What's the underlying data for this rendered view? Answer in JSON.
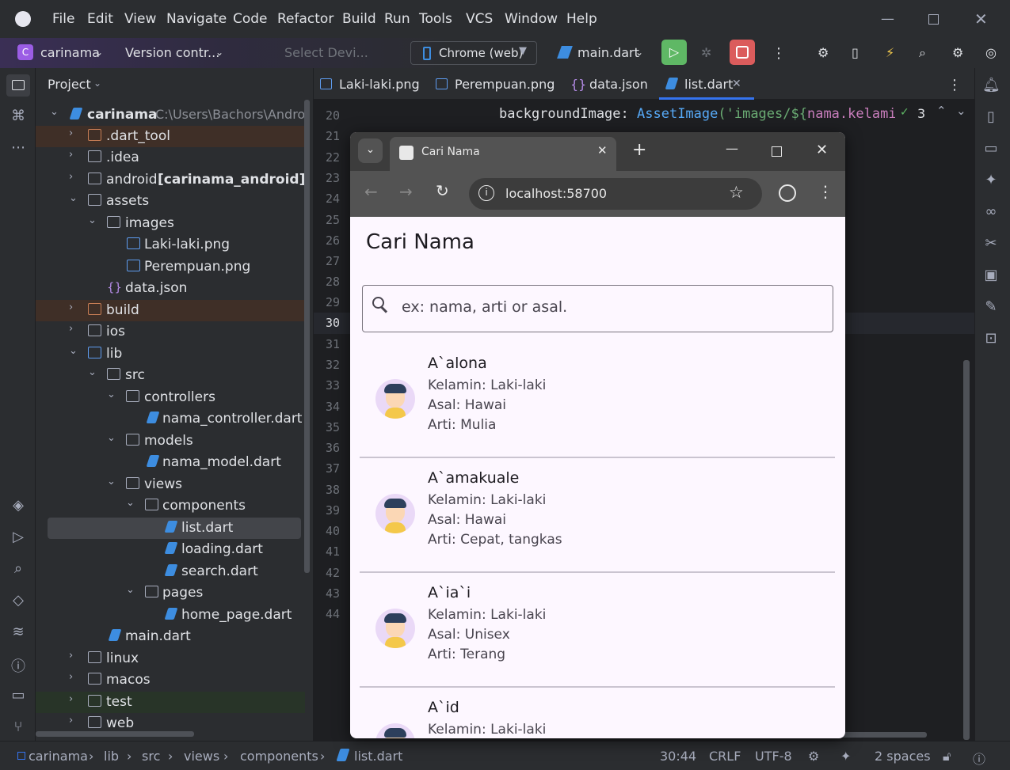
{
  "menu": [
    "File",
    "Edit",
    "View",
    "Navigate",
    "Code",
    "Refactor",
    "Build",
    "Run",
    "Tools",
    "VCS",
    "Window",
    "Help"
  ],
  "toolbar": {
    "project_badge": "C",
    "project": "carinama",
    "vcs": "Version contr...",
    "device_placeholder": "Select Devi...",
    "device": "Chrome (web)",
    "run_config": "main.dart"
  },
  "project_panel": {
    "title": "Project",
    "root_name": "carinama",
    "root_path": "C:\\Users\\Bachors\\Androic",
    "items": [
      {
        "label": ".dart_tool"
      },
      {
        "label": ".idea"
      },
      {
        "label": "android"
      },
      {
        "label": "[carinama_android]"
      },
      {
        "label": "assets"
      },
      {
        "label": "images"
      },
      {
        "label": "Laki-laki.png"
      },
      {
        "label": "Perempuan.png"
      },
      {
        "label": "data.json"
      },
      {
        "label": "build"
      },
      {
        "label": "ios"
      },
      {
        "label": "lib"
      },
      {
        "label": "src"
      },
      {
        "label": "controllers"
      },
      {
        "label": "nama_controller.dart"
      },
      {
        "label": "models"
      },
      {
        "label": "nama_model.dart"
      },
      {
        "label": "views"
      },
      {
        "label": "components"
      },
      {
        "label": "list.dart"
      },
      {
        "label": "loading.dart"
      },
      {
        "label": "search.dart"
      },
      {
        "label": "pages"
      },
      {
        "label": "home_page.dart"
      },
      {
        "label": "main.dart"
      },
      {
        "label": "linux"
      },
      {
        "label": "macos"
      },
      {
        "label": "test"
      },
      {
        "label": "web"
      }
    ]
  },
  "editor": {
    "tabs": [
      "Laki-laki.png",
      "Perempuan.png",
      "data.json",
      "list.dart"
    ],
    "code_line_20": {
      "key": "backgroundImage:",
      "cls": "AssetImage",
      "str": "('images/${",
      "var": "nama.kelamin"
    },
    "warnings": "3",
    "line_numbers": [
      "20",
      "21",
      "22",
      "23",
      "24",
      "25",
      "26",
      "27",
      "28",
      "29",
      "30",
      "31",
      "32",
      "33",
      "34",
      "35",
      "36",
      "37",
      "38",
      "39",
      "40",
      "41",
      "42",
      "43",
      "44"
    ]
  },
  "browser": {
    "tab_title": "Cari Nama",
    "url": "localhost:58700",
    "app_title": "Cari Nama",
    "search_placeholder": "ex: nama, arti or asal.",
    "items": [
      {
        "name": "A`alona",
        "kelamin": "Kelamin: Laki-laki",
        "asal": "Asal: Hawai",
        "arti": "Arti: Mulia"
      },
      {
        "name": "A`amakuale",
        "kelamin": "Kelamin: Laki-laki",
        "asal": "Asal: Hawai",
        "arti": "Arti: Cepat, tangkas"
      },
      {
        "name": "A`ia`i",
        "kelamin": "Kelamin: Laki-laki",
        "asal": "Asal: Unisex",
        "arti": "Arti: Terang"
      },
      {
        "name": "A`id",
        "kelamin": "Kelamin: Laki-laki",
        "asal": "",
        "arti": ""
      }
    ]
  },
  "statusbar": {
    "breadcrumb": [
      "carinama",
      "lib",
      "src",
      "views",
      "components",
      "list.dart"
    ],
    "position": "30:44",
    "line_sep": "CRLF",
    "encoding": "UTF-8",
    "indent": "2 spaces"
  },
  "colors": {
    "accent": "#3574f0",
    "run_green": "#5fb865",
    "stop_red": "#db5c5c",
    "app_bg": "#fdf7ff"
  }
}
